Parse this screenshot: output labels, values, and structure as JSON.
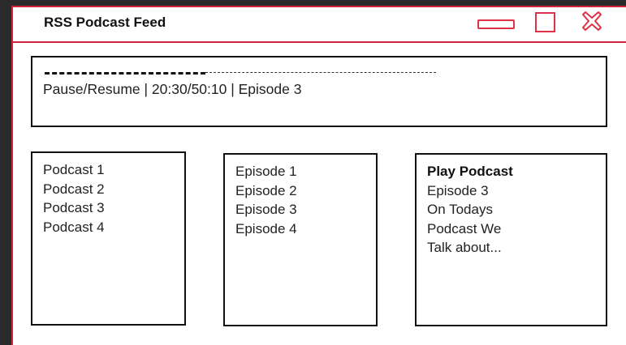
{
  "window": {
    "title": "RSS Podcast Feed"
  },
  "player": {
    "status_text": "Pause/Resume | 20:30/50:10 | Episode 3",
    "progress": 0.41
  },
  "podcasts": [
    "Podcast 1",
    "Podcast 2",
    "Podcast 3",
    "Podcast 4"
  ],
  "episodes": [
    "Episode 1",
    "Episode 2",
    "Episode 3",
    "Episode 4"
  ],
  "now_playing": {
    "heading": "Play Podcast",
    "lines": [
      "Episode 3",
      "On Todays",
      "Podcast We",
      "Talk about..."
    ]
  },
  "colors": {
    "accent": "#e0314a",
    "frame": "#d0243a",
    "background": "#2a2a2c"
  },
  "icons": {
    "minimize": "minimize-icon",
    "maximize": "maximize-icon",
    "close": "close-icon"
  }
}
